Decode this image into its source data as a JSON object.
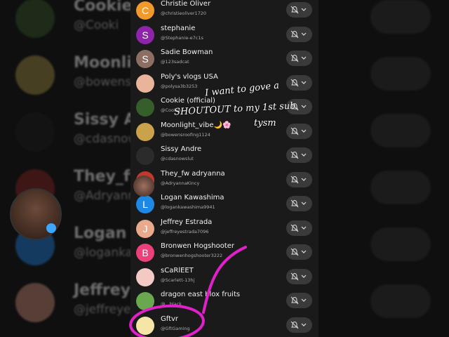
{
  "subscribers": [
    {
      "name": "Christie Oliver",
      "handle": "@christieoliver1720",
      "initial": "C",
      "color": "#f09a2c"
    },
    {
      "name": "stephanie",
      "handle": "@Stephanie-e7c1s",
      "initial": "S",
      "color": "#8e24aa"
    },
    {
      "name": "Sadie Bowman",
      "handle": "@123sadcat",
      "initial": "S",
      "color": "#8d6e63"
    },
    {
      "name": "Poly's vlogs USA",
      "handle": "@polysa3b3253",
      "initial": "",
      "color": "#e8b49a"
    },
    {
      "name": "Cookie (official)",
      "handle": "@Cookie...",
      "initial": "",
      "color": "#355e2a"
    },
    {
      "name": "Moonlight_vibe🌙🌸",
      "handle": "@bowensroofing1124",
      "initial": "",
      "color": "#c9a24a"
    },
    {
      "name": "Sissy Andre",
      "handle": "@cdasnowslut",
      "initial": "",
      "color": "#2b2b2b"
    },
    {
      "name": "They_fw adryanna",
      "handle": "@AdryannaKincy",
      "initial": "",
      "color": "#c0392b"
    },
    {
      "name": "Logan Kawashima",
      "handle": "@logankawashima9941",
      "initial": "L",
      "color": "#1e88e5"
    },
    {
      "name": "Jeffrey Estrada",
      "handle": "@jeffreyestrada7096",
      "initial": "J",
      "color": "#e8a98c"
    },
    {
      "name": "Bronwen Hogshooter",
      "handle": "@bronwenhogshooter3222",
      "initial": "B",
      "color": "#ec407a"
    },
    {
      "name": "sCaRlEET",
      "handle": "@Scarlett-13hj",
      "initial": "",
      "color": "#f3c9c4"
    },
    {
      "name": "dragon east blox fruits",
      "handle": "@...black",
      "initial": "",
      "color": "#6aa84f"
    },
    {
      "name": "Gftvr",
      "handle": "@GftGaming",
      "initial": "",
      "color": "#f5e6a8"
    }
  ],
  "background_rows": [
    {
      "name": "Cookie (o",
      "handle": "@Cooki",
      "color": "#2e4d24"
    },
    {
      "name": "Moonligh",
      "handle": "@bowensro",
      "color": "#8a7a3a"
    },
    {
      "name": "Sissy An",
      "handle": "@cdasnows",
      "color": "#1a1a1a"
    },
    {
      "name": "They_fw",
      "handle": "@Adryanna",
      "color": "#7a2020"
    },
    {
      "name": "Logan K",
      "handle": "@logankaw",
      "color": "#1e6fc2"
    },
    {
      "name": "Jeffrey",
      "handle": "@jeffreye",
      "color": "#b07a68"
    }
  ],
  "overlay_text": {
    "line1": "I want to gove a",
    "line2": "SHOUTOUT to my 1st sub",
    "line3": "tysm"
  },
  "colors": {
    "panel": "#1a1a1a",
    "bell_pill": "#3a3a3a",
    "highlight_circle": "#e020c8"
  },
  "icons": {
    "bell": "bell-off-icon",
    "chevron": "chevron-down-icon"
  }
}
